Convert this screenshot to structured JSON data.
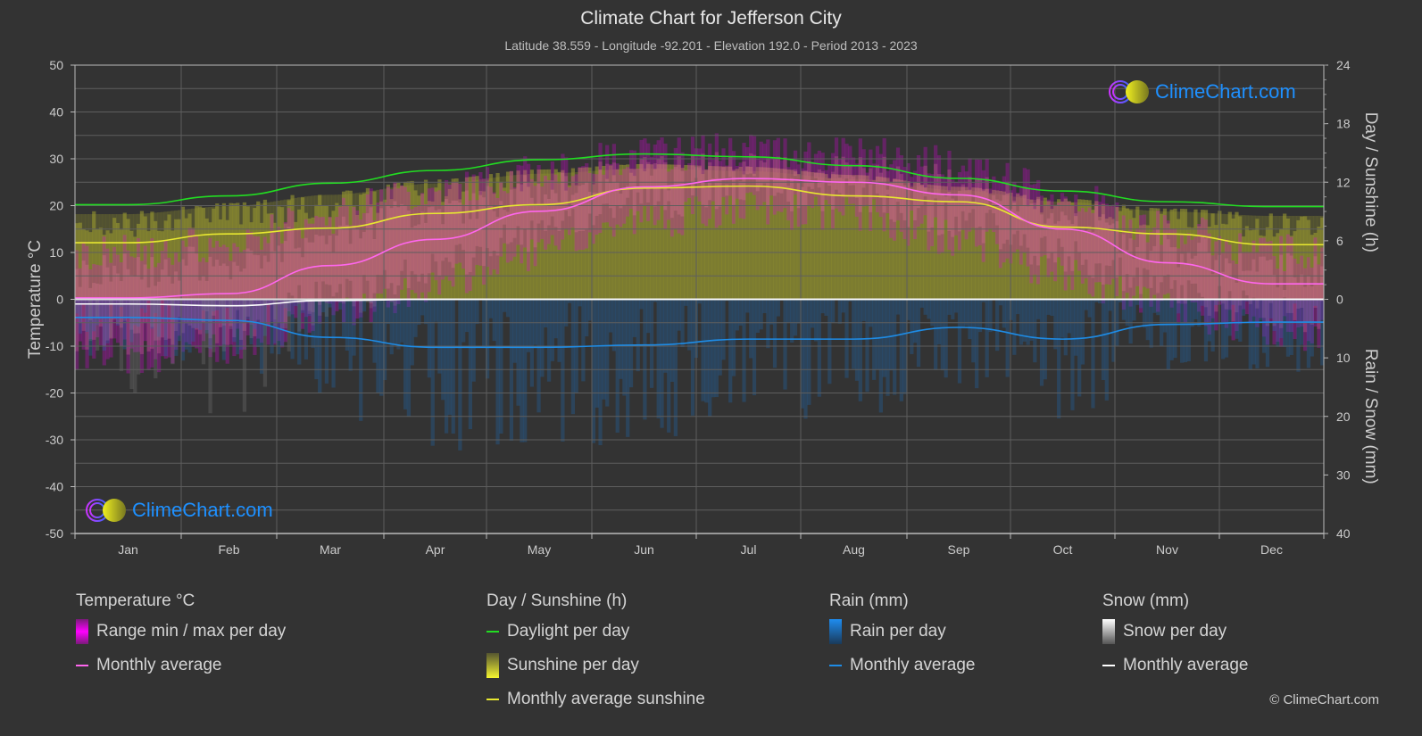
{
  "header": {
    "title": "Climate Chart for Jefferson City",
    "subtitle": "Latitude 38.559 - Longitude -92.201 - Elevation 192.0 - Period 2013 - 2023"
  },
  "logo": {
    "text": "ClimeChart.com"
  },
  "copyright": "© ClimeChart.com",
  "legend": {
    "temperature": {
      "title": "Temperature °C",
      "range": "Range min / max per day",
      "avg": "Monthly average"
    },
    "sunshine": {
      "title": "Day / Sunshine (h)",
      "daylight": "Daylight per day",
      "sunshine": "Sunshine per day",
      "avg": "Monthly average sunshine"
    },
    "rain": {
      "title": "Rain (mm)",
      "perday": "Rain per day",
      "avg": "Monthly average"
    },
    "snow": {
      "title": "Snow (mm)",
      "perday": "Snow per day",
      "avg": "Monthly average"
    }
  },
  "colors": {
    "background": "#333333",
    "grid": "#5e5e5e",
    "temp_avg": "#ff66ee",
    "temp_range": "#e600e6",
    "daylight": "#22dd22",
    "sunshine_avg": "#e8e830",
    "sunshine_bar": "#a0a030",
    "rain": "#1e8ce6",
    "snow": "#ffffff",
    "logo_text": "#1e90ff"
  },
  "chart_data": {
    "type": "area",
    "title": "Climate Chart for Jefferson City",
    "categories": [
      "Jan",
      "Feb",
      "Mar",
      "Apr",
      "May",
      "Jun",
      "Jul",
      "Aug",
      "Sep",
      "Oct",
      "Nov",
      "Dec"
    ],
    "axes": {
      "left": {
        "label": "Temperature °C",
        "range": [
          -50,
          50
        ],
        "ticks": [
          50,
          40,
          30,
          20,
          10,
          0,
          -10,
          -20,
          -30,
          -40,
          -50
        ]
      },
      "right_top": {
        "label": "Day / Sunshine (h)",
        "range": [
          0,
          24
        ],
        "ticks": [
          24,
          18,
          12,
          6,
          0
        ]
      },
      "right_bottom": {
        "label": "Rain / Snow (mm)",
        "range": [
          0,
          40
        ],
        "ticks": [
          10,
          20,
          30,
          40
        ]
      }
    },
    "grid": true,
    "series": [
      {
        "name": "Temperature monthly average",
        "unit": "°C",
        "values": [
          0.3,
          1.2,
          7.2,
          12.8,
          18.8,
          24.0,
          25.8,
          25.0,
          22.3,
          15.0,
          7.8,
          3.3
        ]
      },
      {
        "name": "Temperature range max (approx)",
        "unit": "°C",
        "values": [
          10,
          12,
          18,
          23,
          27,
          31,
          32,
          31,
          29,
          22,
          15,
          10
        ]
      },
      {
        "name": "Temperature range min (approx)",
        "unit": "°C",
        "values": [
          -12,
          -10,
          -3,
          3,
          10,
          17,
          19,
          18,
          13,
          5,
          -2,
          -7
        ]
      },
      {
        "name": "Daylight per day",
        "unit": "h",
        "values": [
          9.7,
          10.6,
          11.9,
          13.2,
          14.3,
          14.9,
          14.6,
          13.7,
          12.4,
          11.1,
          10.0,
          9.5
        ]
      },
      {
        "name": "Monthly average sunshine",
        "unit": "h",
        "values": [
          5.8,
          6.7,
          7.3,
          8.8,
          9.7,
          11.4,
          11.6,
          10.6,
          10.0,
          7.4,
          6.7,
          5.6
        ]
      },
      {
        "name": "Rain monthly average",
        "unit": "mm",
        "values": [
          3.1,
          3.6,
          6.5,
          8.2,
          8.2,
          7.8,
          6.8,
          6.8,
          4.8,
          6.8,
          4.3,
          3.9
        ]
      },
      {
        "name": "Snow monthly average",
        "unit": "mm",
        "values": [
          0.8,
          1.1,
          0.2,
          0,
          0,
          0,
          0,
          0,
          0,
          0,
          0,
          0
        ]
      }
    ]
  }
}
